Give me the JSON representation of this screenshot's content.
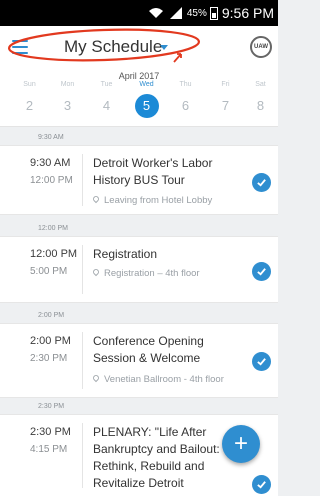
{
  "status_bar": {
    "battery": "45%",
    "time": "9:56 PM"
  },
  "app_bar": {
    "title": "My Schedule",
    "logo_text": "UAW"
  },
  "calendar": {
    "month": "April 2017",
    "days": [
      {
        "name": "Sun",
        "num": "2"
      },
      {
        "name": "Mon",
        "num": "3"
      },
      {
        "name": "Tue",
        "num": "4"
      },
      {
        "name": "Wed",
        "num": "5"
      },
      {
        "name": "Thu",
        "num": "6"
      },
      {
        "name": "Fri",
        "num": "7"
      },
      {
        "name": "Sat",
        "num": "8"
      }
    ],
    "selected_day": "5"
  },
  "dividers": [
    "9:30 AM",
    "12:00 PM",
    "2:00 PM",
    "2:30 PM"
  ],
  "events": [
    {
      "start": "9:30 AM",
      "end": "12:00 PM",
      "title": "Detroit Worker's Labor History BUS Tour",
      "location": "Leaving from Hotel Lobby"
    },
    {
      "start": "12:00 PM",
      "end": "5:00 PM",
      "title": "Registration",
      "location": "Registration – 4th floor"
    },
    {
      "start": "2:00 PM",
      "end": "2:30 PM",
      "title": "Conference Opening Session & Welcome",
      "location": "Venetian Ballroom - 4th floor"
    },
    {
      "start": "2:30 PM",
      "end": "4:15 PM",
      "title": "PLENARY: \"Life After Bankruptcy and Bailout: Rethink, Rebuild and Revitalize Detroit",
      "location": ""
    }
  ],
  "fab_label": "+",
  "colors": {
    "accent": "#2f8ed0",
    "annotation": "#e2391f",
    "background": "#eef0f2"
  }
}
